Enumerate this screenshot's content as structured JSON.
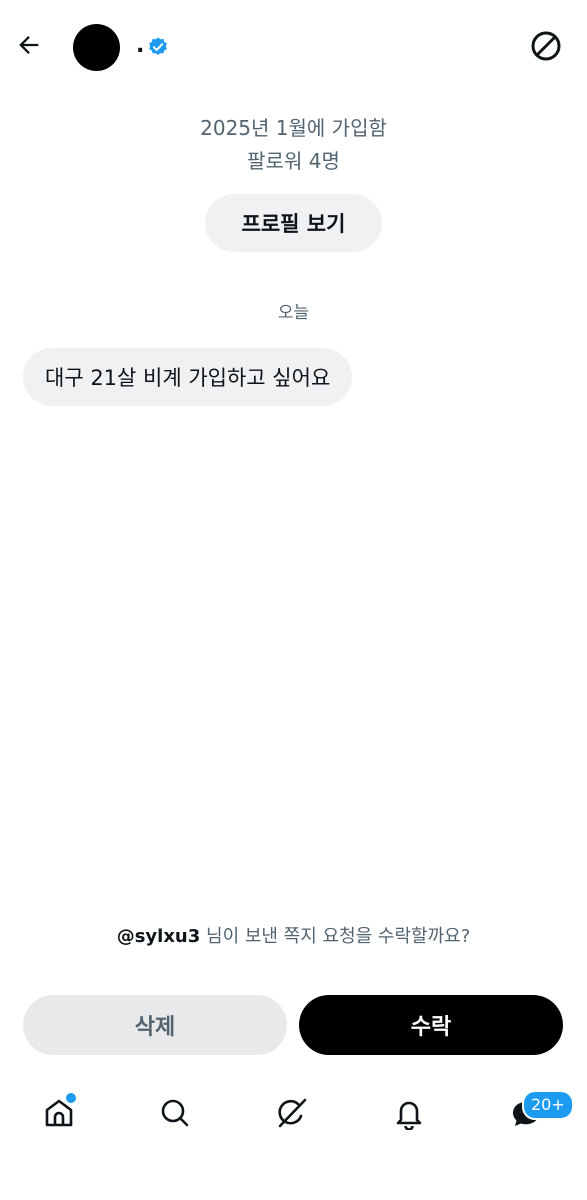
{
  "header": {
    "display_name": ".",
    "back_icon": "arrow-left-icon",
    "verified_icon": "verified-badge-icon",
    "block_icon": "block-icon"
  },
  "profile": {
    "joined": "2025년 1월에 가입함",
    "followers": "팔로워 4명",
    "view_profile_label": "프로필 보기"
  },
  "conversation": {
    "day_label": "오늘",
    "messages": [
      {
        "text": "대구 21살 비계 가입하고 싶어요"
      }
    ]
  },
  "request": {
    "handle": "@sylxu3",
    "question": " 님이 보낸 쪽지 요청을 수락할까요?",
    "delete_label": "삭제",
    "accept_label": "수락"
  },
  "nav": {
    "items": [
      {
        "name": "home",
        "icon": "home-icon"
      },
      {
        "name": "search",
        "icon": "search-icon"
      },
      {
        "name": "grok",
        "icon": "grok-icon"
      },
      {
        "name": "notifications",
        "icon": "bell-icon"
      },
      {
        "name": "messages",
        "icon": "message-icon"
      }
    ],
    "messages_badge": "20+"
  },
  "colors": {
    "accent": "#1d9bf0",
    "text_primary": "#0f1419",
    "text_secondary": "#536471",
    "bubble_bg": "#eff1f2",
    "accept_bg": "#000000"
  }
}
